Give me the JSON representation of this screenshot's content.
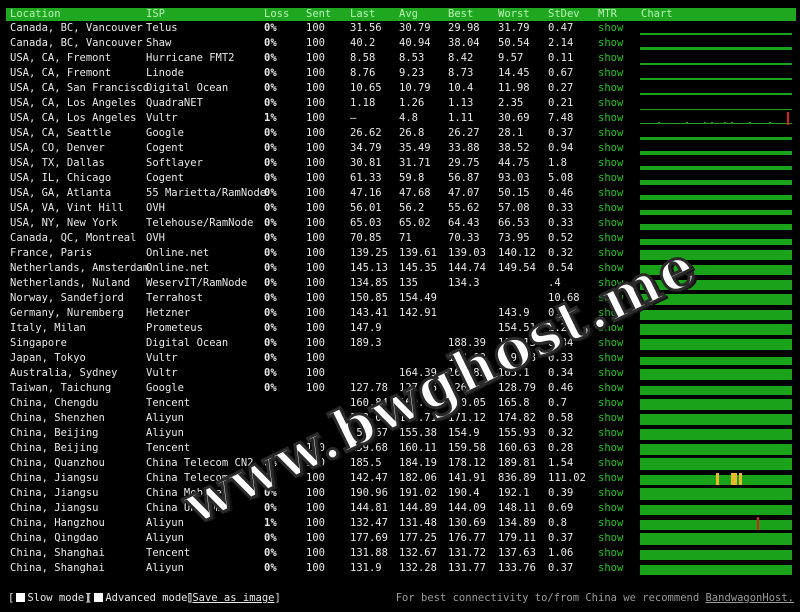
{
  "columns": [
    "Location",
    "ISP",
    "Loss",
    "Sent",
    "Last",
    "Avg",
    "Best",
    "Worst",
    "StDev",
    "MTR",
    "Chart"
  ],
  "rows": [
    {
      "location": "Canada, BC, Vancouver",
      "isp": "Telus",
      "loss": "0%",
      "sent": "100",
      "last": "31.56",
      "avg": "30.79",
      "best": "29.98",
      "worst": "31.79",
      "stdev": "0.47",
      "mtr": "show"
    },
    {
      "location": "Canada, BC, Vancouver",
      "isp": "Shaw",
      "loss": "0%",
      "sent": "100",
      "last": "40.2",
      "avg": "40.94",
      "best": "38.04",
      "worst": "50.54",
      "stdev": "2.14",
      "mtr": "show"
    },
    {
      "location": "USA, CA, Fremont",
      "isp": "Hurricane FMT2",
      "loss": "0%",
      "sent": "100",
      "last": "8.58",
      "avg": "8.53",
      "best": "8.42",
      "worst": "9.57",
      "stdev": "0.11",
      "mtr": "show"
    },
    {
      "location": "USA, CA, Fremont",
      "isp": "Linode",
      "loss": "0%",
      "sent": "100",
      "last": "8.76",
      "avg": "9.23",
      "best": "8.73",
      "worst": "14.45",
      "stdev": "0.67",
      "mtr": "show"
    },
    {
      "location": "USA, CA, San Francisco",
      "isp": "Digital Ocean",
      "loss": "0%",
      "sent": "100",
      "last": "10.65",
      "avg": "10.79",
      "best": "10.4",
      "worst": "11.98",
      "stdev": "0.27",
      "mtr": "show"
    },
    {
      "location": "USA, CA, Los Angeles",
      "isp": "QuadraNET",
      "loss": "0%",
      "sent": "100",
      "last": "1.18",
      "avg": "1.26",
      "best": "1.13",
      "worst": "2.35",
      "stdev": "0.21",
      "mtr": "show"
    },
    {
      "location": "USA, CA, Los Angeles",
      "isp": "Vultr",
      "loss": "1%",
      "sent": "100",
      "last": "–",
      "avg": "4.8",
      "best": "1.11",
      "worst": "30.69",
      "stdev": "7.48",
      "mtr": "show"
    },
    {
      "location": "USA, CA, Seattle",
      "isp": "Google",
      "loss": "0%",
      "sent": "100",
      "last": "26.62",
      "avg": "26.8",
      "best": "26.27",
      "worst": "28.1",
      "stdev": "0.37",
      "mtr": "show"
    },
    {
      "location": "USA, CO, Denver",
      "isp": "Cogent",
      "loss": "0%",
      "sent": "100",
      "last": "34.79",
      "avg": "35.49",
      "best": "33.88",
      "worst": "38.52",
      "stdev": "0.94",
      "mtr": "show"
    },
    {
      "location": "USA, TX, Dallas",
      "isp": "Softlayer",
      "loss": "0%",
      "sent": "100",
      "last": "30.81",
      "avg": "31.71",
      "best": "29.75",
      "worst": "44.75",
      "stdev": "1.8",
      "mtr": "show"
    },
    {
      "location": "USA, IL, Chicago",
      "isp": "Cogent",
      "loss": "0%",
      "sent": "100",
      "last": "61.33",
      "avg": "59.8",
      "best": "56.87",
      "worst": "93.03",
      "stdev": "5.08",
      "mtr": "show"
    },
    {
      "location": "USA, GA, Atlanta",
      "isp": "55 Marietta/RamNode",
      "loss": "0%",
      "sent": "100",
      "last": "47.16",
      "avg": "47.68",
      "best": "47.07",
      "worst": "50.15",
      "stdev": "0.46",
      "mtr": "show"
    },
    {
      "location": "USA, VA, Vint Hill",
      "isp": "OVH",
      "loss": "0%",
      "sent": "100",
      "last": "56.01",
      "avg": "56.2",
      "best": "55.62",
      "worst": "57.08",
      "stdev": "0.33",
      "mtr": "show"
    },
    {
      "location": "USA, NY, New York",
      "isp": "Telehouse/RamNode",
      "loss": "0%",
      "sent": "100",
      "last": "65.03",
      "avg": "65.02",
      "best": "64.43",
      "worst": "66.53",
      "stdev": "0.33",
      "mtr": "show"
    },
    {
      "location": "Canada, QC, Montreal",
      "isp": "OVH",
      "loss": "0%",
      "sent": "100",
      "last": "70.85",
      "avg": "71",
      "best": "70.33",
      "worst": "73.95",
      "stdev": "0.52",
      "mtr": "show"
    },
    {
      "location": "France, Paris",
      "isp": "Online.net",
      "loss": "0%",
      "sent": "100",
      "last": "139.25",
      "avg": "139.61",
      "best": "139.03",
      "worst": "140.12",
      "stdev": "0.32",
      "mtr": "show"
    },
    {
      "location": "Netherlands, Amsterdam",
      "isp": "Online.net",
      "loss": "0%",
      "sent": "100",
      "last": "145.13",
      "avg": "145.35",
      "best": "144.74",
      "worst": "149.54",
      "stdev": "0.54",
      "mtr": "show"
    },
    {
      "location": "Netherlands, Nuland",
      "isp": "WeservIT/RamNode",
      "loss": "0%",
      "sent": "100",
      "last": "134.85",
      "avg": "135",
      "best": "134.3",
      "worst": "",
      "stdev": ".4",
      "mtr": "show"
    },
    {
      "location": "Norway, Sandefjord",
      "isp": "Terrahost",
      "loss": "0%",
      "sent": "100",
      "last": "150.85",
      "avg": "154.49",
      "best": "",
      "worst": "",
      "stdev": "10.68",
      "mtr": "show"
    },
    {
      "location": "Germany, Nuremberg",
      "isp": "Hetzner",
      "loss": "0%",
      "sent": "100",
      "last": "143.41",
      "avg": "142.91",
      "best": "",
      "worst": "143.9",
      "stdev": "0.34",
      "mtr": "show"
    },
    {
      "location": "Italy, Milan",
      "isp": "Prometeus",
      "loss": "0%",
      "sent": "100",
      "last": "147.9",
      "avg": "",
      "best": "",
      "worst": "154.51",
      "stdev": "1.26",
      "mtr": "show"
    },
    {
      "location": "Singapore",
      "isp": "Digital Ocean",
      "loss": "0%",
      "sent": "100",
      "last": "189.3",
      "avg": "",
      "best": "188.39",
      "worst": "190.13",
      "stdev": "0.34",
      "mtr": "show"
    },
    {
      "location": "Japan, Tokyo",
      "isp": "Vultr",
      "loss": "0%",
      "sent": "100",
      "last": "",
      "avg": "",
      "best": "108.09",
      "worst": "109.38",
      "stdev": "0.33",
      "mtr": "show"
    },
    {
      "location": "Australia, Sydney",
      "isp": "Vultr",
      "loss": "0%",
      "sent": "100",
      "last": "",
      "avg": "164.39",
      "best": "163.82",
      "worst": "165.1",
      "stdev": "0.34",
      "mtr": "show"
    },
    {
      "location": "Taiwan, Taichung",
      "isp": "Google",
      "loss": "0%",
      "sent": "100",
      "last": "127.78",
      "avg": "127.66",
      "best": "126.4",
      "worst": "128.79",
      "stdev": "0.46",
      "mtr": "show"
    },
    {
      "location": "China, Chengdu",
      "isp": "Tencent",
      "loss": "",
      "sent": "",
      "last": "160.84",
      "avg": "160.66",
      "best": "160.05",
      "worst": "165.8",
      "stdev": "0.7",
      "mtr": "show"
    },
    {
      "location": "China, Shenzhen",
      "isp": "Aliyun",
      "loss": "",
      "sent": "",
      "last": "172.06",
      "avg": "171.71",
      "best": "171.12",
      "worst": "174.82",
      "stdev": "0.58",
      "mtr": "show"
    },
    {
      "location": "China, Beijing",
      "isp": "Aliyun",
      "loss": "",
      "sent": "",
      "last": "155.67",
      "avg": "155.38",
      "best": "154.9",
      "worst": "155.93",
      "stdev": "0.32",
      "mtr": "show"
    },
    {
      "location": "China, Beijing",
      "isp": "Tencent",
      "loss": "",
      "sent": "100",
      "last": "159.68",
      "avg": "160.11",
      "best": "159.58",
      "worst": "160.63",
      "stdev": "0.28",
      "mtr": "show"
    },
    {
      "location": "China, Quanzhou",
      "isp": "China Telecom CN2",
      "loss": "0%",
      "sent": "100",
      "last": "185.5",
      "avg": "184.19",
      "best": "178.12",
      "worst": "189.81",
      "stdev": "1.54",
      "mtr": "show"
    },
    {
      "location": "China, Jiangsu",
      "isp": "China Telecom",
      "loss": "0%",
      "sent": "100",
      "last": "142.47",
      "avg": "182.06",
      "best": "141.91",
      "worst": "836.89",
      "stdev": "111.02",
      "mtr": "show"
    },
    {
      "location": "China, Jiangsu",
      "isp": "China Mobile",
      "loss": "0%",
      "sent": "100",
      "last": "190.96",
      "avg": "191.02",
      "best": "190.4",
      "worst": "192.1",
      "stdev": "0.39",
      "mtr": "show"
    },
    {
      "location": "China, Jiangsu",
      "isp": "China Unicom",
      "loss": "0%",
      "sent": "100",
      "last": "144.81",
      "avg": "144.89",
      "best": "144.09",
      "worst": "148.11",
      "stdev": "0.69",
      "mtr": "show"
    },
    {
      "location": "China, Hangzhou",
      "isp": "Aliyun",
      "loss": "1%",
      "sent": "100",
      "last": "132.47",
      "avg": "131.48",
      "best": "130.69",
      "worst": "134.89",
      "stdev": "0.8",
      "mtr": "show"
    },
    {
      "location": "China, Qingdao",
      "isp": "Aliyun",
      "loss": "0%",
      "sent": "100",
      "last": "177.69",
      "avg": "177.25",
      "best": "176.77",
      "worst": "179.11",
      "stdev": "0.37",
      "mtr": "show"
    },
    {
      "location": "China, Shanghai",
      "isp": "Tencent",
      "loss": "0%",
      "sent": "100",
      "last": "131.88",
      "avg": "132.67",
      "best": "131.72",
      "worst": "137.63",
      "stdev": "1.06",
      "mtr": "show"
    },
    {
      "location": "China, Shanghai",
      "isp": "Aliyun",
      "loss": "0%",
      "sent": "100",
      "last": "131.9",
      "avg": "132.28",
      "best": "131.77",
      "worst": "133.76",
      "stdev": "0.37",
      "mtr": "show"
    }
  ],
  "charts": [
    {
      "level": 0.1
    },
    {
      "level": 0.15
    },
    {
      "level": 0.05
    },
    {
      "level": 0.05
    },
    {
      "level": 0.08
    },
    {
      "level": 0.02
    },
    {
      "level": 0.0,
      "sparse": true,
      "loss_at": 0.97
    },
    {
      "level": 0.2
    },
    {
      "level": 0.25
    },
    {
      "level": 0.22
    },
    {
      "level": 0.35
    },
    {
      "level": 0.3
    },
    {
      "level": 0.35
    },
    {
      "level": 0.4
    },
    {
      "level": 0.45
    },
    {
      "level": 0.75
    },
    {
      "level": 0.78
    },
    {
      "level": 0.72
    },
    {
      "level": 0.8
    },
    {
      "level": 0.78
    },
    {
      "level": 0.8
    },
    {
      "level": 0.85
    },
    {
      "level": 0.62
    },
    {
      "level": 0.85
    },
    {
      "level": 0.7
    },
    {
      "level": 0.85
    },
    {
      "level": 0.85
    },
    {
      "level": 0.82
    },
    {
      "level": 0.85
    },
    {
      "level": 0.88
    },
    {
      "level": 0.78,
      "spikes_at": [
        0.5,
        0.6,
        0.62,
        0.65
      ]
    },
    {
      "level": 0.9
    },
    {
      "level": 0.78
    },
    {
      "level": 0.75,
      "loss_at": 0.77
    },
    {
      "level": 0.88
    },
    {
      "level": 0.75
    },
    {
      "level": 0.75
    }
  ],
  "colors": {
    "header_bg": "#1fa81f",
    "bar": "#1aa31a",
    "spike": "#e8b92a",
    "loss": "#d42020",
    "show_link": "#22c522"
  },
  "watermark": "www.bwghost.me",
  "footer": {
    "slow_mode": "Slow mode",
    "advanced_mode": "Advanced mode",
    "save_image": "Save as image",
    "note": "For best connectivity to/from China we recommend ",
    "note_link": "BandwagonHost."
  }
}
